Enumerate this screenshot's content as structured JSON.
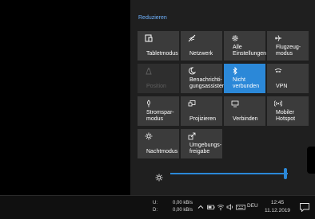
{
  "action_center": {
    "collapse_label": "Reduzieren",
    "accent_color": "#2b88d8",
    "tiles": [
      {
        "label": "Tabletmodus",
        "icon": "tablet-mode-icon",
        "state": "off"
      },
      {
        "label": "Netzwerk",
        "icon": "network-icon",
        "state": "off"
      },
      {
        "label": "Alle\nEinstellungen",
        "icon": "gear-icon",
        "state": "off"
      },
      {
        "label": "Flugzeug-\nmodus",
        "icon": "airplane-icon",
        "state": "off"
      },
      {
        "label": "Position",
        "icon": "location-icon",
        "state": "disabled"
      },
      {
        "label": "Benachrichti-\ngungsassistent",
        "icon": "moon-icon",
        "state": "off"
      },
      {
        "label": "Nicht\nverbunden",
        "icon": "bluetooth-icon",
        "state": "on"
      },
      {
        "label": "VPN",
        "icon": "vpn-icon",
        "state": "off"
      },
      {
        "label": "Stromspar-\nmodus",
        "icon": "battery-saver-icon",
        "state": "off"
      },
      {
        "label": "Projizieren",
        "icon": "project-icon",
        "state": "off"
      },
      {
        "label": "Verbinden",
        "icon": "connect-icon",
        "state": "off"
      },
      {
        "label": "Mobiler\nHotspot",
        "icon": "hotspot-icon",
        "state": "off"
      },
      {
        "label": "Nachtmodus",
        "icon": "night-light-icon",
        "state": "off"
      },
      {
        "label": "Umgebungs-\nfreigabe",
        "icon": "nearby-sharing-icon",
        "state": "off"
      }
    ],
    "brightness_icon": "sun-icon",
    "brightness_level": 1.0
  },
  "taskbar": {
    "net_upload_label": "U:",
    "net_download_label": "D:",
    "net_upload_value": "0,00 kB/s",
    "net_download_value": "0,00 kB/s",
    "language": "DEU",
    "time": "12:45",
    "date": "11.12.2019",
    "tray_icons": [
      "chevron-up-icon",
      "battery-icon",
      "wifi-icon",
      "volume-icon",
      "keyboard-icon"
    ],
    "notification_icon": "notification-icon"
  }
}
